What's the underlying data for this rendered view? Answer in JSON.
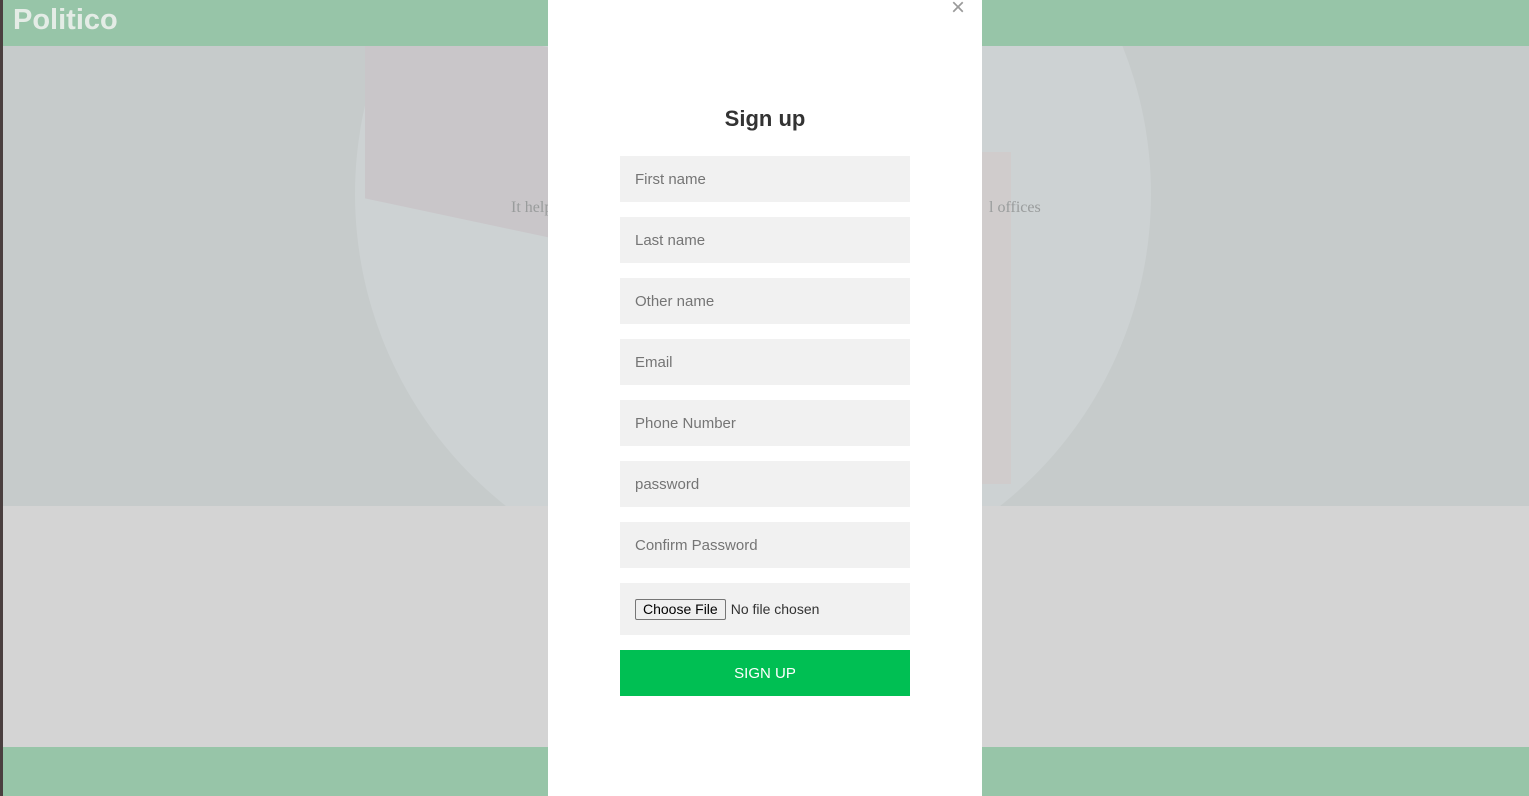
{
  "navbar": {
    "brand": "Politico"
  },
  "hero": {
    "text_left": "It help",
    "text_right": "l offices"
  },
  "modal": {
    "close_glyph": "×",
    "title": "Sign up",
    "fields": {
      "first_name": {
        "placeholder": "First name"
      },
      "last_name": {
        "placeholder": "Last name"
      },
      "other_name": {
        "placeholder": "Other name"
      },
      "email": {
        "placeholder": "Email"
      },
      "phone": {
        "placeholder": "Phone Number"
      },
      "password": {
        "placeholder": "password"
      },
      "confirm_password": {
        "placeholder": "Confirm Password"
      }
    },
    "file": {
      "button_label": "Choose File",
      "status": "No file chosen"
    },
    "submit_label": "SIGN UP"
  },
  "colors": {
    "navbar": "#97c5a8",
    "accent_button": "#00bf53",
    "field_bg": "#f1f1f1"
  }
}
